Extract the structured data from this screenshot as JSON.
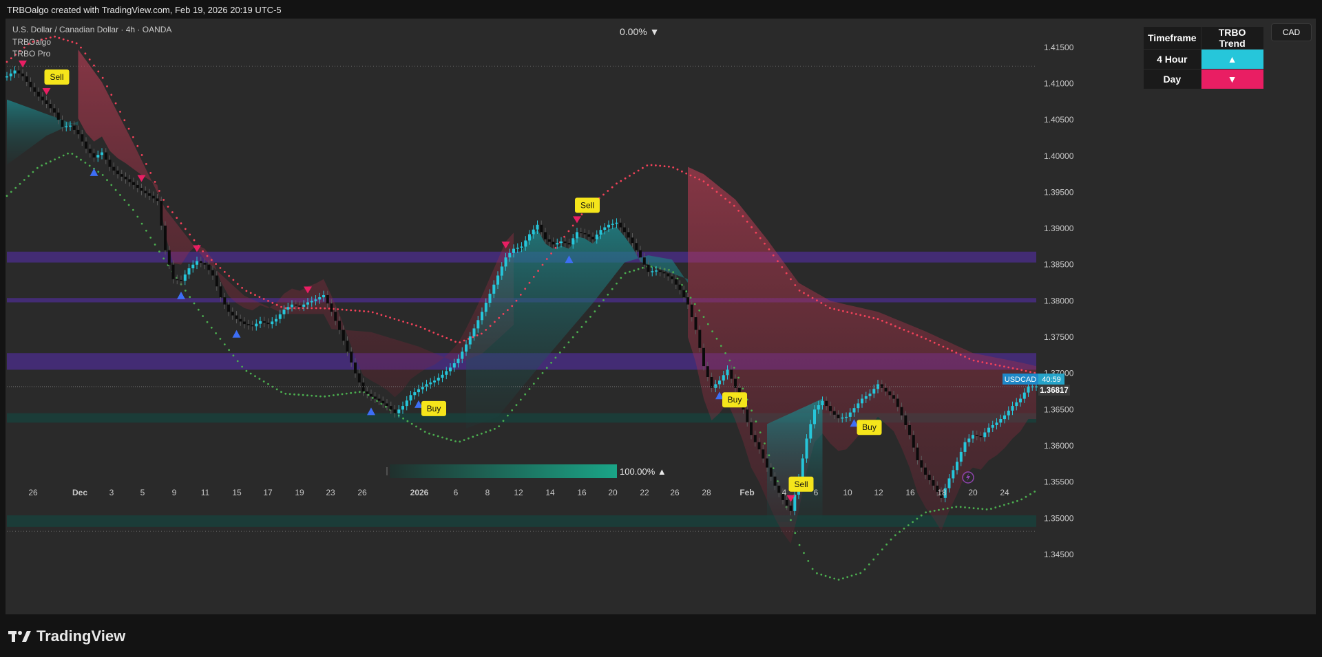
{
  "header": {
    "attribution": "TRBOalgo created with TradingView.com, Feb 19, 2026 20:19 UTC-5"
  },
  "legend": {
    "symbol_line": "U.S. Dollar / Canadian Dollar · 4h · OANDA",
    "indicator_1": "TRBOalgo",
    "indicator_2": "TRBO Pro"
  },
  "change_top": "0.00% ▼",
  "currency_button": "CAD",
  "trend_table": {
    "header_timeframe": "Timeframe",
    "header_trend": "TRBO Trend",
    "rows": [
      {
        "timeframe": "4 Hour",
        "trend": "up",
        "arrow": "▲"
      },
      {
        "timeframe": "Day",
        "trend": "down",
        "arrow": "▼"
      }
    ]
  },
  "gauge": {
    "label": "100.00% ▲",
    "level": 1.0
  },
  "price_tag": {
    "symbol": "USDCAD",
    "countdown": "40:59",
    "price": "1.36817"
  },
  "brand": {
    "name": "TradingView"
  },
  "colors": {
    "bull": "#26c6da",
    "bear_candle": "#0b0b0b",
    "sell_marker": "#e91e63",
    "buy_marker": "#3d6ef5",
    "label_bg": "#f5e51b",
    "zone": "#5b2dbe",
    "teal_zone": "#0f4a44",
    "upper_trail": "#f4425a",
    "lower_trail": "#4caf50"
  },
  "chart_data": {
    "type": "candlestick",
    "title": "U.S. Dollar / Canadian Dollar · 4h · OANDA",
    "ylim": [
      1.343,
      1.4185
    ],
    "y_ticks": [
      "1.41500",
      "1.41000",
      "1.40500",
      "1.40000",
      "1.39500",
      "1.39000",
      "1.38500",
      "1.38000",
      "1.37500",
      "1.37000",
      "1.36500",
      "1.36000",
      "1.35500",
      "1.35000",
      "1.34500"
    ],
    "x_ticks": [
      "26",
      "Dec",
      "3",
      "5",
      "9",
      "11",
      "15",
      "17",
      "19",
      "23",
      "26",
      "2026",
      "6",
      "8",
      "12",
      "14",
      "16",
      "20",
      "22",
      "26",
      "28",
      "Feb",
      "4",
      "6",
      "10",
      "12",
      "16",
      "18",
      "20",
      "24"
    ],
    "last_price": 1.36817,
    "close_path": [
      [
        0,
        1.411
      ],
      [
        1,
        1.4118
      ],
      [
        2,
        1.411
      ],
      [
        3,
        1.4095
      ],
      [
        4,
        1.4082
      ],
      [
        5,
        1.4072
      ],
      [
        6,
        1.406
      ],
      [
        7,
        1.404
      ],
      [
        8,
        1.4042
      ],
      [
        9,
        1.403
      ],
      [
        10,
        1.401
      ],
      [
        11,
        1.3998
      ],
      [
        12,
        1.4005
      ],
      [
        13,
        1.3985
      ],
      [
        14,
        1.3975
      ],
      [
        15,
        1.3968
      ],
      [
        16,
        1.396
      ],
      [
        17,
        1.3952
      ],
      [
        18,
        1.3945
      ],
      [
        19,
        1.3938
      ],
      [
        20,
        1.387
      ],
      [
        21,
        1.383
      ],
      [
        22,
        1.3828
      ],
      [
        23,
        1.3845
      ],
      [
        24,
        1.3855
      ],
      [
        25,
        1.385
      ],
      [
        26,
        1.3835
      ],
      [
        27,
        1.3805
      ],
      [
        28,
        1.3785
      ],
      [
        29,
        1.3775
      ],
      [
        30,
        1.3768
      ],
      [
        31,
        1.3765
      ],
      [
        32,
        1.3772
      ],
      [
        33,
        1.3768
      ],
      [
        34,
        1.3775
      ],
      [
        35,
        1.3788
      ],
      [
        36,
        1.3795
      ],
      [
        37,
        1.3792
      ],
      [
        38,
        1.3798
      ],
      [
        39,
        1.3802
      ],
      [
        40,
        1.3808
      ],
      [
        41,
        1.3785
      ],
      [
        42,
        1.376
      ],
      [
        43,
        1.373
      ],
      [
        44,
        1.37
      ],
      [
        45,
        1.3675
      ],
      [
        46,
        1.3668
      ],
      [
        47,
        1.3662
      ],
      [
        48,
        1.3655
      ],
      [
        49,
        1.3645
      ],
      [
        50,
        1.3655
      ],
      [
        51,
        1.367
      ],
      [
        52,
        1.3678
      ],
      [
        53,
        1.3685
      ],
      [
        54,
        1.369
      ],
      [
        55,
        1.3698
      ],
      [
        56,
        1.3708
      ],
      [
        57,
        1.372
      ],
      [
        58,
        1.374
      ],
      [
        59,
        1.3762
      ],
      [
        60,
        1.3785
      ],
      [
        61,
        1.381
      ],
      [
        62,
        1.3835
      ],
      [
        63,
        1.386
      ],
      [
        64,
        1.3872
      ],
      [
        65,
        1.3875
      ],
      [
        66,
        1.3892
      ],
      [
        67,
        1.3905
      ],
      [
        68,
        1.3885
      ],
      [
        69,
        1.3878
      ],
      [
        70,
        1.3882
      ],
      [
        71,
        1.3878
      ],
      [
        72,
        1.3895
      ],
      [
        73,
        1.3892
      ],
      [
        74,
        1.3885
      ],
      [
        75,
        1.3898
      ],
      [
        76,
        1.3905
      ],
      [
        77,
        1.3908
      ],
      [
        78,
        1.3895
      ],
      [
        79,
        1.388
      ],
      [
        80,
        1.386
      ],
      [
        81,
        1.384
      ],
      [
        82,
        1.3842
      ],
      [
        83,
        1.3838
      ],
      [
        84,
        1.383
      ],
      [
        85,
        1.3815
      ],
      [
        86,
        1.3795
      ],
      [
        87,
        1.376
      ],
      [
        88,
        1.371
      ],
      [
        89,
        1.368
      ],
      [
        90,
        1.369
      ],
      [
        91,
        1.3705
      ],
      [
        92,
        1.368
      ],
      [
        93,
        1.365
      ],
      [
        94,
        1.3615
      ],
      [
        95,
        1.3595
      ],
      [
        96,
        1.357
      ],
      [
        97,
        1.3545
      ],
      [
        98,
        1.3525
      ],
      [
        99,
        1.351
      ],
      [
        100,
        1.3555
      ],
      [
        101,
        1.361
      ],
      [
        102,
        1.365
      ],
      [
        103,
        1.3662
      ],
      [
        104,
        1.3648
      ],
      [
        105,
        1.3638
      ],
      [
        106,
        1.364
      ],
      [
        107,
        1.3652
      ],
      [
        108,
        1.3665
      ],
      [
        109,
        1.3672
      ],
      [
        110,
        1.3685
      ],
      [
        111,
        1.3675
      ],
      [
        112,
        1.3665
      ],
      [
        113,
        1.3642
      ],
      [
        114,
        1.3615
      ],
      [
        115,
        1.358
      ],
      [
        116,
        1.356
      ],
      [
        117,
        1.3545
      ],
      [
        118,
        1.3528
      ],
      [
        119,
        1.3555
      ],
      [
        120,
        1.3578
      ],
      [
        121,
        1.3605
      ],
      [
        122,
        1.3615
      ],
      [
        123,
        1.3612
      ],
      [
        124,
        1.3625
      ],
      [
        125,
        1.3632
      ],
      [
        126,
        1.3642
      ],
      [
        127,
        1.3655
      ],
      [
        128,
        1.3665
      ],
      [
        129,
        1.3682
      ],
      [
        130,
        1.3682
      ]
    ],
    "upper_trail": [
      [
        0,
        1.413
      ],
      [
        3,
        1.4157
      ],
      [
        6,
        1.4165
      ],
      [
        9,
        1.4155
      ],
      [
        12,
        1.411
      ],
      [
        16,
        1.4025
      ],
      [
        20,
        1.3935
      ],
      [
        25,
        1.3865
      ],
      [
        30,
        1.3815
      ],
      [
        35,
        1.379
      ],
      [
        40,
        1.379
      ],
      [
        46,
        1.3785
      ],
      [
        52,
        1.3765
      ],
      [
        57,
        1.3742
      ],
      [
        60,
        1.3755
      ],
      [
        64,
        1.3795
      ],
      [
        68,
        1.3855
      ],
      [
        73,
        1.3925
      ],
      [
        77,
        1.3962
      ],
      [
        81,
        1.3988
      ],
      [
        84,
        1.3985
      ],
      [
        88,
        1.3965
      ],
      [
        92,
        1.393
      ],
      [
        96,
        1.3875
      ],
      [
        100,
        1.3815
      ],
      [
        104,
        1.379
      ],
      [
        110,
        1.3775
      ],
      [
        116,
        1.3748
      ],
      [
        122,
        1.3718
      ],
      [
        128,
        1.3705
      ],
      [
        130,
        1.37
      ]
    ],
    "lower_trail": [
      [
        0,
        1.3945
      ],
      [
        4,
        1.3985
      ],
      [
        8,
        1.4005
      ],
      [
        12,
        1.3975
      ],
      [
        16,
        1.3925
      ],
      [
        20,
        1.3855
      ],
      [
        25,
        1.3775
      ],
      [
        30,
        1.3705
      ],
      [
        35,
        1.3672
      ],
      [
        40,
        1.3668
      ],
      [
        45,
        1.3675
      ],
      [
        50,
        1.3638
      ],
      [
        53,
        1.3618
      ],
      [
        57,
        1.3605
      ],
      [
        62,
        1.3625
      ],
      [
        68,
        1.3705
      ],
      [
        74,
        1.3782
      ],
      [
        78,
        1.3838
      ],
      [
        81,
        1.3848
      ],
      [
        84,
        1.3842
      ],
      [
        88,
        1.3778
      ],
      [
        92,
        1.3705
      ],
      [
        96,
        1.3595
      ],
      [
        100,
        1.3465
      ],
      [
        102,
        1.3425
      ],
      [
        105,
        1.3415
      ],
      [
        108,
        1.3425
      ],
      [
        112,
        1.3475
      ],
      [
        116,
        1.3508
      ],
      [
        120,
        1.3516
      ],
      [
        124,
        1.3512
      ],
      [
        128,
        1.3525
      ],
      [
        130,
        1.3538
      ]
    ],
    "zones": [
      [
        1.3853,
        1.3868
      ],
      [
        1.3798,
        1.3804
      ],
      [
        1.3705,
        1.3728
      ],
      [
        1.3632,
        1.3645
      ],
      [
        1.3488,
        1.3504
      ]
    ],
    "markers": [
      {
        "type": "sell",
        "x": 2,
        "label": ""
      },
      {
        "type": "sell",
        "x": 5,
        "label": "Sell"
      },
      {
        "type": "buy",
        "x": 11,
        "label": ""
      },
      {
        "type": "sell",
        "x": 17,
        "label": ""
      },
      {
        "type": "buy",
        "x": 22,
        "label": ""
      },
      {
        "type": "sell",
        "x": 24,
        "label": ""
      },
      {
        "type": "buy",
        "x": 29,
        "label": ""
      },
      {
        "type": "sell",
        "x": 38,
        "label": ""
      },
      {
        "type": "buy",
        "x": 46,
        "label": ""
      },
      {
        "type": "buy",
        "x": 52,
        "label": "Buy"
      },
      {
        "type": "sell",
        "x": 63,
        "label": ""
      },
      {
        "type": "buy",
        "x": 71,
        "label": ""
      },
      {
        "type": "sell",
        "x": 72,
        "label": "Sell"
      },
      {
        "type": "buy",
        "x": 90,
        "label": "Buy"
      },
      {
        "type": "sell",
        "x": 99,
        "label": "Sell"
      },
      {
        "type": "buy",
        "x": 107,
        "label": "Buy"
      }
    ]
  }
}
